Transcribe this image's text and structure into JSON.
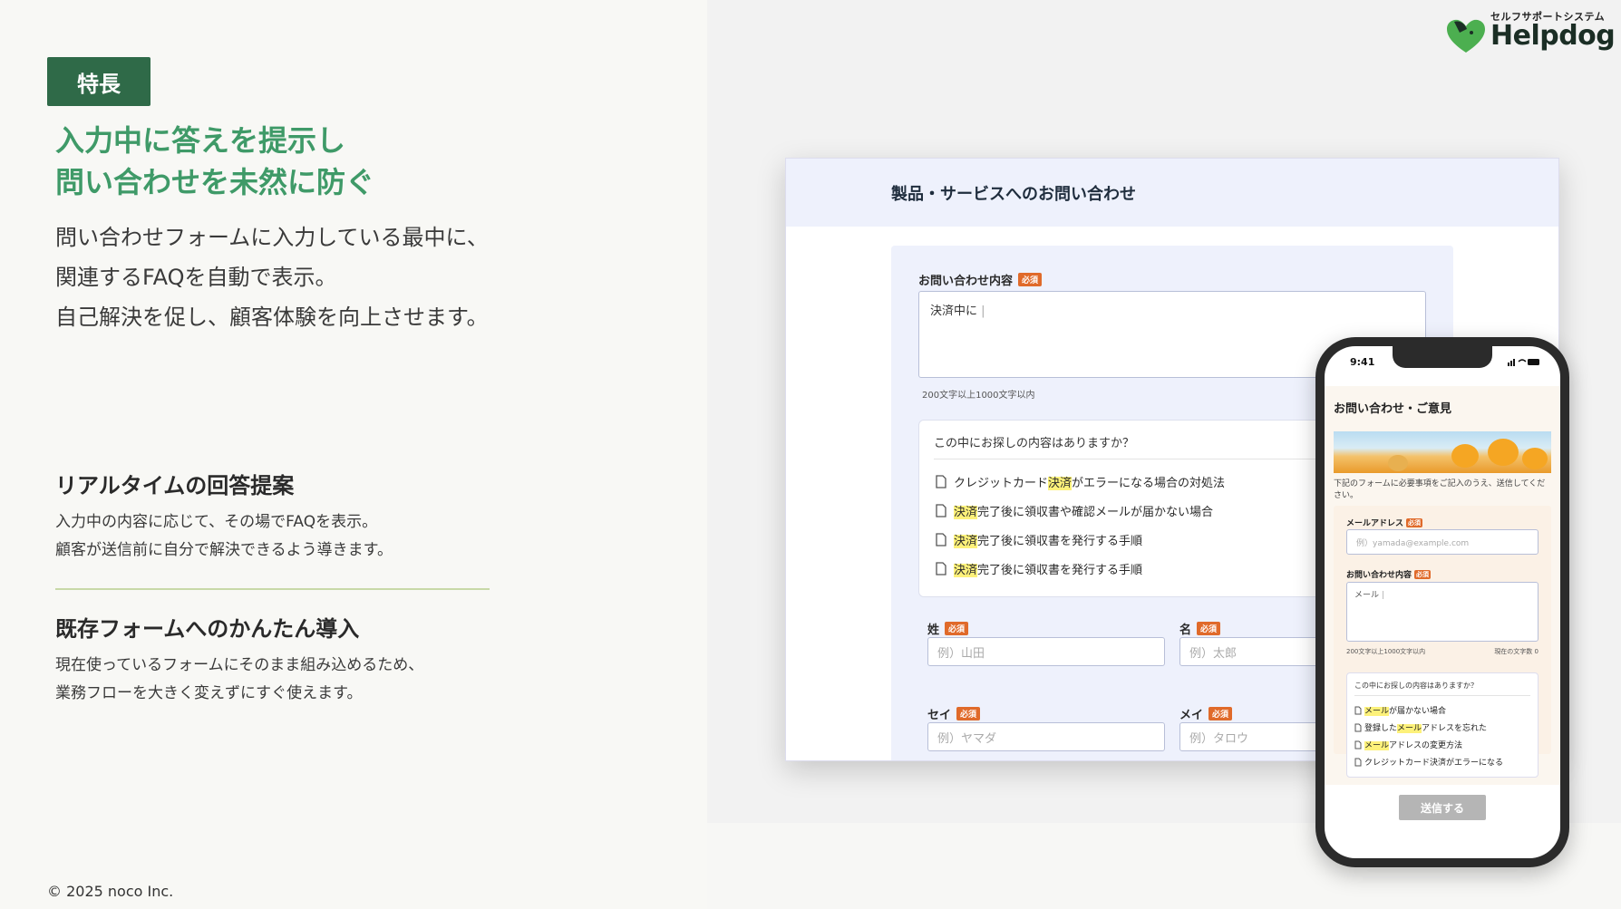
{
  "badge": "特長",
  "headline": [
    "入力中に答えを提示し",
    "問い合わせを未然に防ぐ"
  ],
  "intro": [
    "問い合わせフォームに入力している最中に、",
    "関連するFAQを自動で表示。",
    "自己解決を促し、顧客体験を向上させます。"
  ],
  "features": [
    {
      "title": "リアルタイムの回答提案",
      "lines": [
        "入力中の内容に応じて、その場でFAQを表示。",
        "顧客が送信前に自分で解決できるよう導きます。"
      ]
    },
    {
      "title": "既存フォームへのかんたん導入",
      "lines": [
        "現在使っているフォームにそのまま組み込めるため、",
        "業務フローを大きく変えずにすぐ使えます。"
      ]
    }
  ],
  "copyright": "© 2025 noco Inc.",
  "logo": {
    "subtitle": "セルフサポートシステム",
    "name": "Helpdog"
  },
  "desktop_form": {
    "title": "製品・サービスへのお問い合わせ",
    "inquiry_label": "お問い合わせ内容",
    "required": "必須",
    "inquiry_value": "決済中に",
    "char_hint": "200文字以上1000文字以内",
    "suggest_title": "この中にお探しの内容はありますか？",
    "suggestions": [
      {
        "pre": "クレジットカード",
        "hl": "決済",
        "post": "がエラーになる場合の対処法"
      },
      {
        "pre": "",
        "hl": "決済",
        "post": "完了後に領収書や確認メールが届かない場合"
      },
      {
        "pre": "",
        "hl": "決済",
        "post": "完了後に領収書を発行する手順"
      },
      {
        "pre": "",
        "hl": "決済",
        "post": "完了後に領収書を発行する手順"
      }
    ],
    "last_name_label": "姓",
    "first_name_label": "名",
    "last_name_placeholder": "例）山田",
    "first_name_placeholder": "例）太郎",
    "last_kana_label": "セイ",
    "first_kana_label": "メイ",
    "last_kana_placeholder": "例）ヤマダ",
    "first_kana_placeholder": "例）タロウ"
  },
  "phone": {
    "time": "9:41",
    "title": "お問い合わせ・ご意見",
    "description": "下記のフォームに必要事項をご記入のうえ、送信してください。",
    "email_label": "メールアドレス",
    "email_placeholder": "例）yamada@example.com",
    "inquiry_label": "お問い合わせ内容",
    "required": "必須",
    "inquiry_value": "メール",
    "char_hint": "200文字以上1000文字以内",
    "current_count": "現在の文字数 0",
    "suggest_title": "この中にお探しの内容はありますか？",
    "suggestions": [
      {
        "pre": "",
        "hl": "メール",
        "post": "が届かない場合"
      },
      {
        "pre": "登録した",
        "hl": "メール",
        "post": "アドレスを忘れた"
      },
      {
        "pre": "",
        "hl": "メール",
        "post": "アドレスの変更方法"
      },
      {
        "pre": "クレジットカード決済がエラーになる",
        "hl": "",
        "post": ""
      }
    ],
    "submit": "送信する"
  },
  "colors": {
    "accent_green": "#2f6a48",
    "headline_green": "#3f9a68",
    "required_orange": "#e06a2a",
    "highlight_yellow": "#fdf17a"
  }
}
